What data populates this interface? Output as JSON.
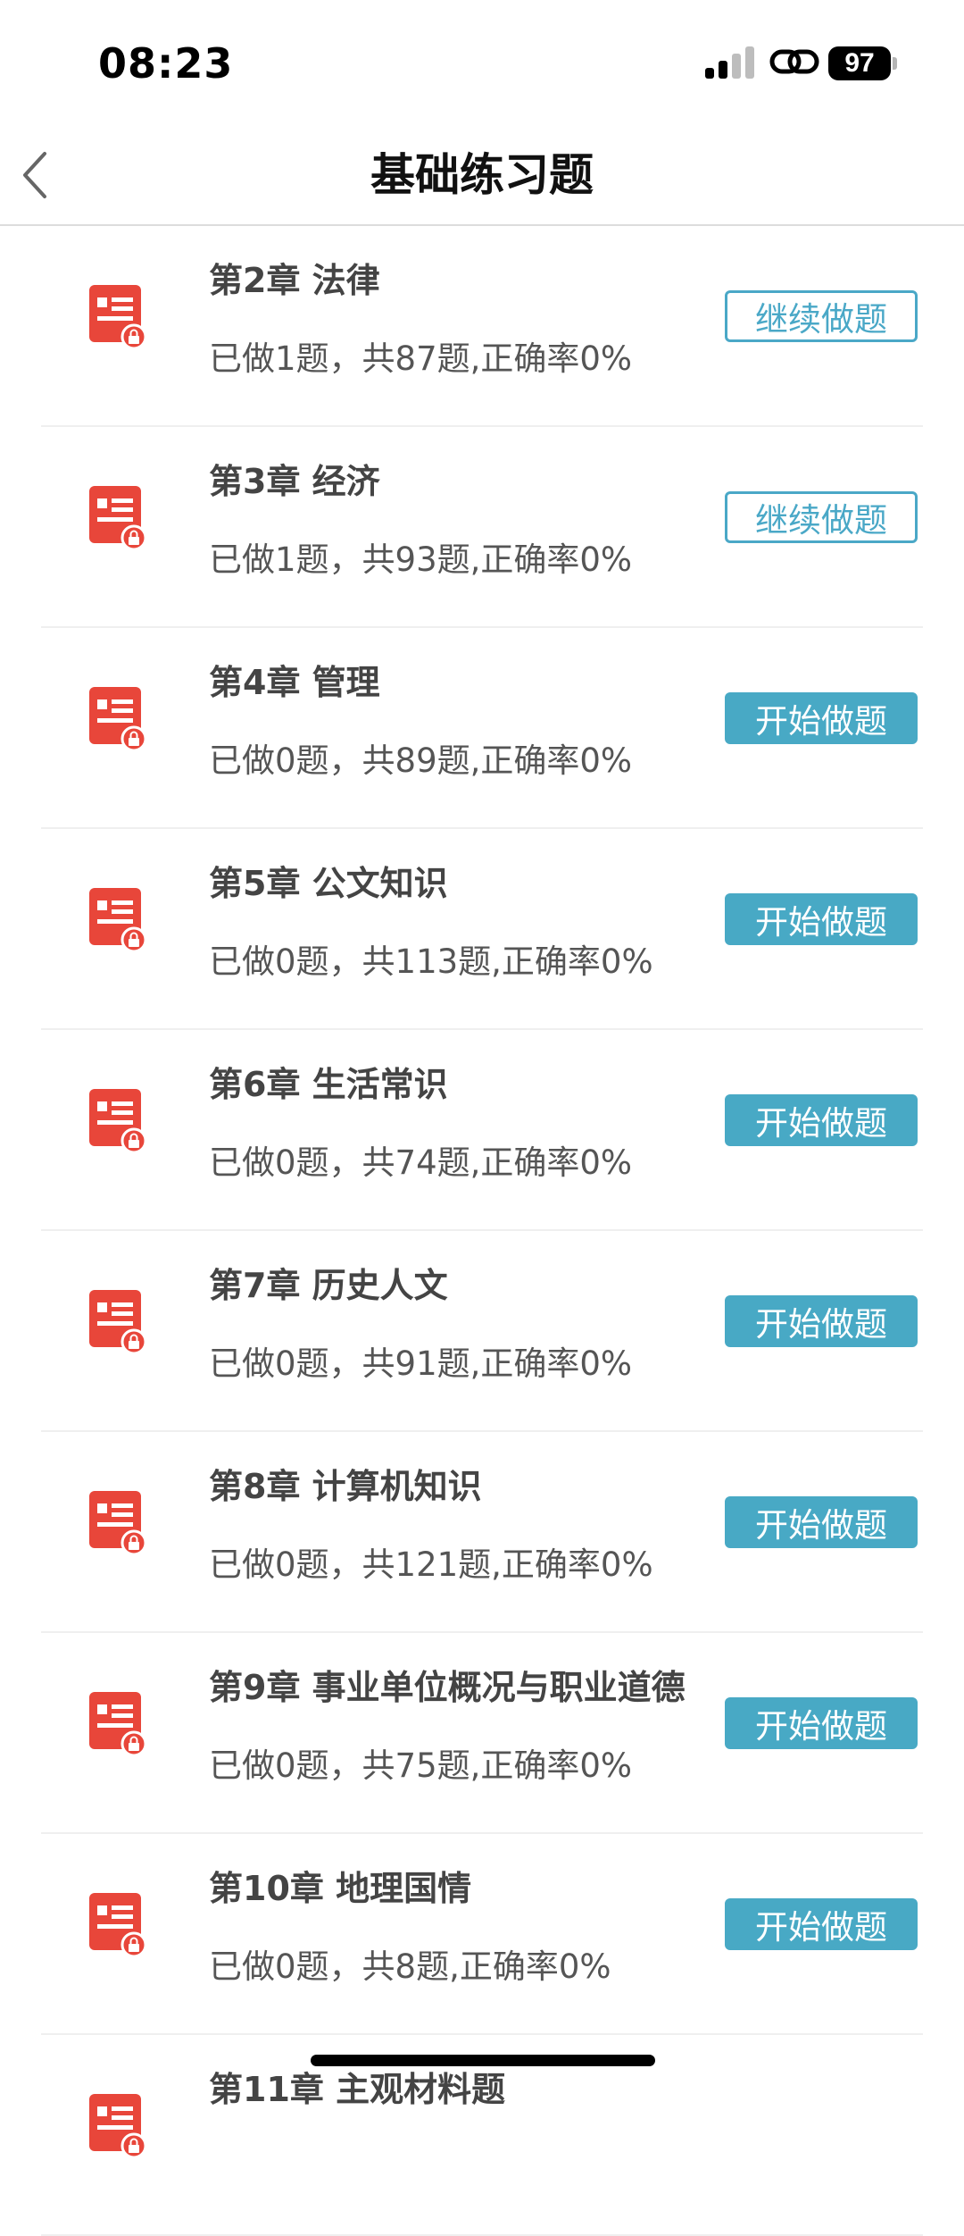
{
  "status_bar": {
    "time": "08:23",
    "battery": "97",
    "icons": [
      "signal-icon",
      "link-icon",
      "battery-icon"
    ]
  },
  "header": {
    "title": "基础练习题",
    "back_icon": "chevron-left-icon"
  },
  "colors": {
    "accent": "#48a9c5",
    "icon_red": "#e8463a",
    "text_dark": "#444444",
    "text_muted": "#555555",
    "divider": "#efefef"
  },
  "chapters": [
    {
      "title": "第2章  法律",
      "stats": "已做1题，共87题,正确率0%",
      "action": "继续做题",
      "style": "outline"
    },
    {
      "title": "第3章  经济",
      "stats": "已做1题，共93题,正确率0%",
      "action": "继续做题",
      "style": "outline"
    },
    {
      "title": "第4章  管理",
      "stats": "已做0题，共89题,正确率0%",
      "action": "开始做题",
      "style": "filled"
    },
    {
      "title": "第5章  公文知识",
      "stats": "已做0题，共113题,正确率0%",
      "action": "开始做题",
      "style": "filled"
    },
    {
      "title": "第6章  生活常识",
      "stats": "已做0题，共74题,正确率0%",
      "action": "开始做题",
      "style": "filled"
    },
    {
      "title": "第7章  历史人文",
      "stats": "已做0题，共91题,正确率0%",
      "action": "开始做题",
      "style": "filled"
    },
    {
      "title": "第8章  计算机知识",
      "stats": "已做0题，共121题,正确率0%",
      "action": "开始做题",
      "style": "filled"
    },
    {
      "title": "第9章  事业单位概况与职业道德",
      "stats": "已做0题，共75题,正确率0%",
      "action": "开始做题",
      "style": "filled"
    },
    {
      "title": "第10章  地理国情",
      "stats": "已做0题，共8题,正确率0%",
      "action": "开始做题",
      "style": "filled"
    },
    {
      "title": "第11章  主观材料题",
      "stats": "",
      "action": "",
      "style": "filled"
    }
  ]
}
